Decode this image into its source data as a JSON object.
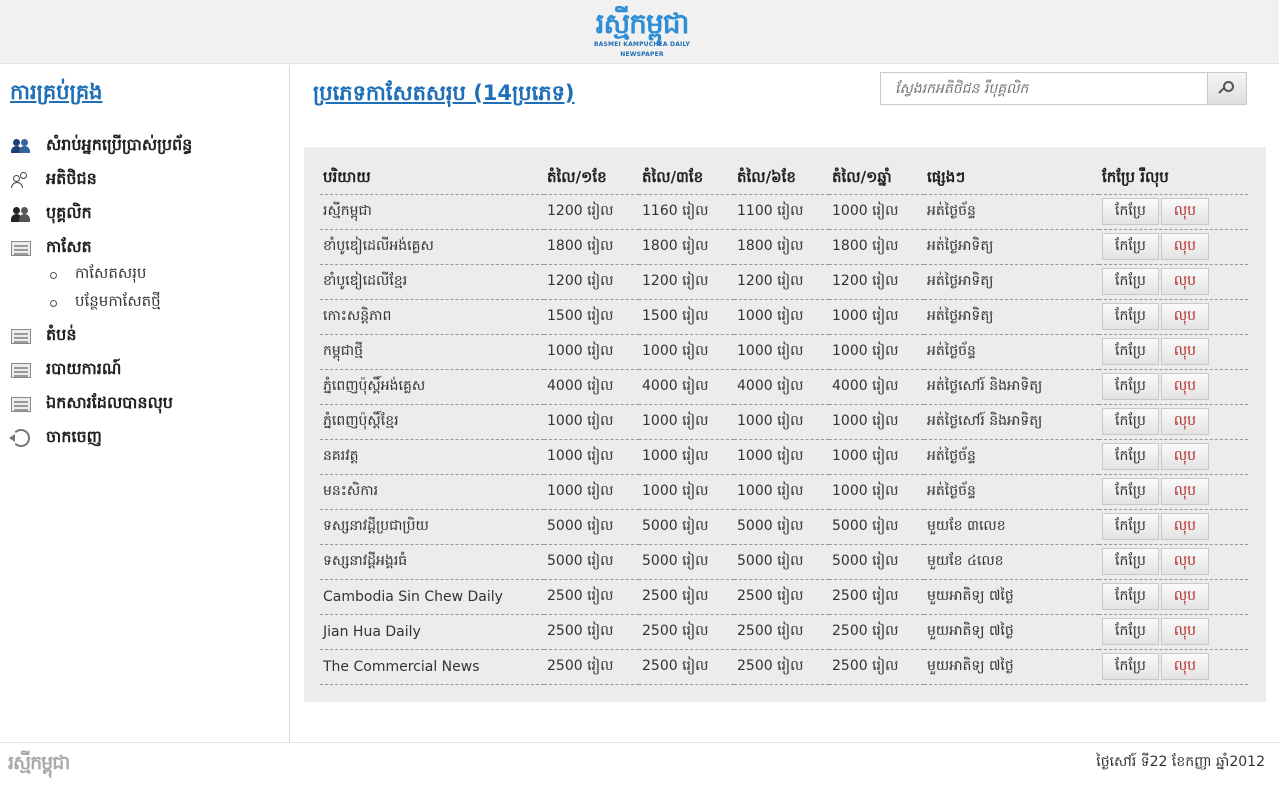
{
  "header": {
    "logo_text": "រស្មីកម្ពុជា",
    "logo_subtext": "BASMEI KAMPUCHEA DAILY NEWSPAPER"
  },
  "sidebar": {
    "title": "ការគ្រប់គ្រង",
    "items": [
      {
        "label": "សំរាប់អ្នកប្រើប្រាស់ប្រព័ន្ធ",
        "icon": "users-icon"
      },
      {
        "label": "អតិថិជន",
        "icon": "guests-icon"
      },
      {
        "label": "បុគ្គលិក",
        "icon": "staff-icon"
      },
      {
        "label": "កាសែត",
        "icon": "document-icon"
      },
      {
        "label": "តំបន់",
        "icon": "document-icon"
      },
      {
        "label": "របាយការណ៍",
        "icon": "document-icon"
      },
      {
        "label": "ឯកសារដែលបានលុប",
        "icon": "document-icon"
      },
      {
        "label": "ចាកចេញ",
        "icon": "logout-icon"
      }
    ],
    "subitems": [
      {
        "label": "កាសែតសរុប"
      },
      {
        "label": "បន្ថែមកាសែតថ្មី"
      }
    ]
  },
  "main": {
    "title": "ប្រភេទកាសែតសរុប (14ប្រភេទ)",
    "search": {
      "placeholder": "ស្វែងរកអតិថិជន រឺបុគ្គលិក",
      "value": ""
    },
    "table": {
      "headers": [
        "បរិយាយ",
        "តំលៃ/១ខែ",
        "តំលៃ/៣ខែ",
        "តំលៃ/៦ខែ",
        "តំលៃ/១ឆ្នាំ",
        "ផ្សេងៗ",
        "កែប្រែ រឺលុប"
      ],
      "edit_label": "កែប្រែ",
      "delete_label": "លុប",
      "rows": [
        {
          "name": "រស្មីកម្ពុជា",
          "m1": "1200 រៀល",
          "m3": "1160 រៀល",
          "m6": "1100 រៀល",
          "y1": "1000 រៀល",
          "note": "អត់ថ្ងៃច័ន្ទ"
        },
        {
          "name": "ខាំបូឌៀដេលីអង់គ្លេស",
          "m1": "1800 រៀល",
          "m3": "1800 រៀល",
          "m6": "1800 រៀល",
          "y1": "1800 រៀល",
          "note": "អត់ថ្ងៃអាទិត្យ"
        },
        {
          "name": "ខាំបូឌៀដេលីខ្មែរ",
          "m1": "1200 រៀល",
          "m3": "1200 រៀល",
          "m6": "1200 រៀល",
          "y1": "1200 រៀល",
          "note": "អត់ថ្ងៃអាទិត្យ"
        },
        {
          "name": "កោះសន្តិភាព",
          "m1": "1500 រៀល",
          "m3": "1500 រៀល",
          "m6": "1000 រៀល",
          "y1": "1000 រៀល",
          "note": "អត់ថ្ងៃអាទិត្យ"
        },
        {
          "name": "កម្ពុជាថ្មី",
          "m1": "1000 រៀល",
          "m3": "1000 រៀល",
          "m6": "1000 រៀល",
          "y1": "1000 រៀល",
          "note": "អត់ថ្ងៃច័ន្ទ"
        },
        {
          "name": "ភ្នំពេញប៉ុស្តិ៍អង់គ្លេស",
          "m1": "4000 រៀល",
          "m3": "4000 រៀល",
          "m6": "4000 រៀល",
          "y1": "4000 រៀល",
          "note": "អត់ថ្ងៃសៅរ៍ និងអាទិត្យ"
        },
        {
          "name": "ភ្នំពេញប៉ុស្តិ៍ខ្មែរ",
          "m1": "1000 រៀល",
          "m3": "1000 រៀល",
          "m6": "1000 រៀល",
          "y1": "1000 រៀល",
          "note": "អត់ថ្ងៃសៅរ៍ និងអាទិត្យ"
        },
        {
          "name": "នគរវត្ត",
          "m1": "1000 រៀល",
          "m3": "1000 រៀល",
          "m6": "1000 រៀល",
          "y1": "1000 រៀល",
          "note": "អត់ថ្ងៃច័ន្ទ"
        },
        {
          "name": "មនះសិការ",
          "m1": "1000 រៀល",
          "m3": "1000 រៀល",
          "m6": "1000 រៀល",
          "y1": "1000 រៀល",
          "note": "អត់ថ្ងៃច័ន្ទ"
        },
        {
          "name": "ទស្សនាវដ្តីប្រជាប្រិយ",
          "m1": "5000 រៀល",
          "m3": "5000 រៀល",
          "m6": "5000 រៀល",
          "y1": "5000 រៀល",
          "note": "មួយខែ ៣លេខ"
        },
        {
          "name": "ទស្សនាវដ្តីអង្គរធំ",
          "m1": "5000 រៀល",
          "m3": "5000 រៀល",
          "m6": "5000 រៀល",
          "y1": "5000 រៀល",
          "note": "មួយខែ ៤លេខ"
        },
        {
          "name": "Cambodia Sin Chew Daily",
          "m1": "2500 រៀល",
          "m3": "2500 រៀល",
          "m6": "2500 រៀល",
          "y1": "2500 រៀល",
          "note": "មួយអាតិទ្យ ៧ថ្ងៃ"
        },
        {
          "name": "Jian Hua Daily",
          "m1": "2500 រៀល",
          "m3": "2500 រៀល",
          "m6": "2500 រៀល",
          "y1": "2500 រៀល",
          "note": "មួយអាតិទ្យ ៧ថ្ងៃ"
        },
        {
          "name": "The Commercial News",
          "m1": "2500 រៀល",
          "m3": "2500 រៀល",
          "m6": "2500 រៀល",
          "y1": "2500 រៀល",
          "note": "មួយអាតិទ្យ ៧ថ្ងៃ"
        }
      ]
    }
  },
  "footer": {
    "logo_text": "រស្មីកម្ពុជា",
    "date": "ថ្ងៃសៅរ៍ ទី22 ខែកញ្ញា ឆ្នាំ2012"
  },
  "colors": {
    "link_blue": "#1f6fb8",
    "delete_red": "#b32d2d",
    "panel_bg": "#ececec",
    "header_bg": "#f1f1f1"
  }
}
